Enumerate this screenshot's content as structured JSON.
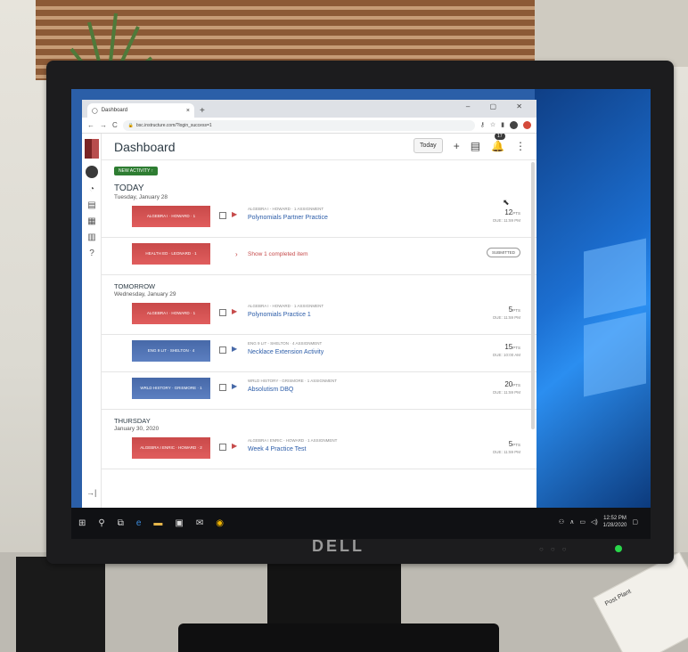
{
  "browser": {
    "tab_title": "Dashboard",
    "tab_close": "×",
    "new_tab": "+",
    "url": "bsc.instructure.com/?login_success=1",
    "window_controls": "–  ▢  ✕"
  },
  "app": {
    "title": "Dashboard",
    "today_button": "Today",
    "notification_count": "17",
    "new_activity_label": "NEW ACTIVITY ↑"
  },
  "days": [
    {
      "name": "TODAY",
      "date": "Tuesday, January 28",
      "items": [
        {
          "course": "ALGEBRA I · HOWARD · 1",
          "meta": "ALGEBRA I - HOWARD · 1 ASSIGNMENT",
          "title": "Polynomials Partner Practice",
          "points": "12",
          "pts_unit": "PTS",
          "due": "DUE: 11:59 PM"
        },
        {
          "course": "HEALTH ED · LEONARD · 1",
          "completed_text": "Show 1 completed item",
          "status": "SUBMITTED"
        }
      ]
    },
    {
      "name": "TOMORROW",
      "date": "Wednesday, January 29",
      "items": [
        {
          "course": "ALGEBRA I · HOWARD · 1",
          "meta": "ALGEBRA I - HOWARD · 1 ASSIGNMENT",
          "title": "Polynomials Practice 1",
          "points": "5",
          "pts_unit": "PTS",
          "due": "DUE: 11:59 PM"
        },
        {
          "course": "ENG 9 LIT · SHELTON · 4",
          "meta": "ENG 9 LIT - SHELTON · 4 ASSIGNMENT",
          "title": "Necklace Extension Activity",
          "points": "15",
          "pts_unit": "PTS",
          "due": "DUE: 10:00 AM"
        },
        {
          "course": "WRLD HISTORY · GRISMORE · 1",
          "meta": "WRLD HISTORY - GRISMORE · 1 ASSIGNMENT",
          "title": "Absolutism DBQ",
          "points": "20",
          "pts_unit": "PTS",
          "due": "DUE: 11:59 PM"
        }
      ]
    },
    {
      "name": "THURSDAY",
      "date": "January 30, 2020",
      "items": [
        {
          "course": "ALGEBRA I ENRIC · HOWARD · 2",
          "meta": "ALGEBRA I ENRIC - HOWARD · 1 ASSIGNMENT",
          "title": "Week 4 Practice Test",
          "points": "5",
          "pts_unit": "PTS",
          "due": "DUE: 11:59 PM"
        }
      ]
    }
  ],
  "taskbar": {
    "time": "12:52 PM",
    "date": "1/28/2020"
  },
  "monitor": {
    "brand": "DELL"
  },
  "note": {
    "text": "Post Plant"
  },
  "colors": {
    "course_red": "#c94a4a",
    "course_blue": "#4769a8",
    "link": "#2b5ca8",
    "new_activity": "#2e7d32"
  }
}
